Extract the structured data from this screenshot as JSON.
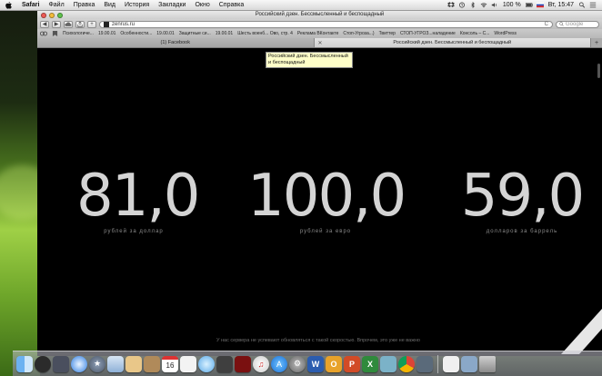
{
  "menubar": {
    "app": "Safari",
    "items": [
      "Файл",
      "Правка",
      "Вид",
      "История",
      "Закладки",
      "Окно",
      "Справка"
    ],
    "battery": "100 %",
    "clock": "Вт, 15:47"
  },
  "window": {
    "title": "Российский дзен. Бессмысленный и беспощадный"
  },
  "toolbar": {
    "back": "◀",
    "forward": "▶",
    "add": "+",
    "url": "zenrus.ru",
    "reload": "C",
    "search_placeholder": "Google"
  },
  "bookmarks": [
    "Психологиче...",
    "19.00.01",
    "Особенности...",
    "19.00.01",
    "Защитные си...",
    "19.00.01",
    "Шесть военб... Ово, стр. 4",
    "Реклама ВКонтакте",
    "Стоп-Угроза...)",
    "Твиттер",
    "СТОП-УГРОЗ...наладение",
    "Консоль – С...",
    "WordPress"
  ],
  "tabs": [
    {
      "label": "(1) Facebook",
      "active": false
    },
    {
      "label": "Российский дзен. Бессмысленный и беспощадный",
      "active": true
    }
  ],
  "tooltip": "Российский дзен. Бессмысленный и беспощадный",
  "stats": [
    {
      "value": "81,0",
      "caption": "рублей за доллар"
    },
    {
      "value": "100,0",
      "caption": "рублей за евро"
    },
    {
      "value": "59,0",
      "caption": "долларов за баррель"
    }
  ],
  "footer_note": "У нас сервера не успевают обновляться с такой скоростью. Впрочем, это уже не важно",
  "dock": {
    "icons": [
      "finder-icon",
      "dashboard-icon",
      "mission-control-icon",
      "safari-icon",
      "launchpad-icon",
      "mail-icon",
      "notes-icon",
      "contacts-icon",
      "calendar-icon",
      "reminders-icon",
      "messages-icon",
      "facetime-icon",
      "photo-booth-icon",
      "itunes-icon",
      "app-store-icon",
      "preferences-icon",
      "word-icon",
      "outlook-icon",
      "powerpoint-icon",
      "excel-icon",
      "folder-icon",
      "documents-icon",
      "trash-icon"
    ],
    "calendar_day": "16"
  }
}
